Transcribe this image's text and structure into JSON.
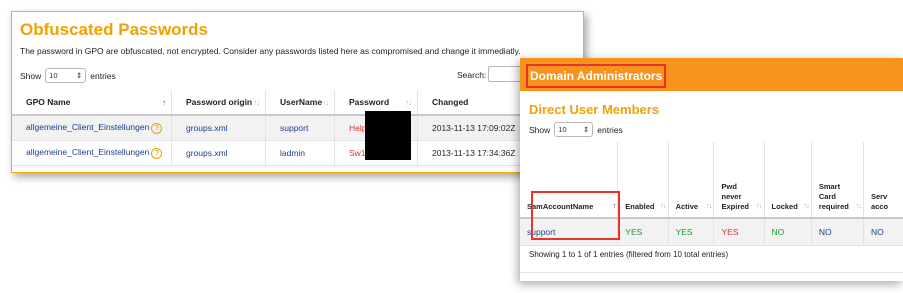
{
  "gpo_panel": {
    "title": "Obfuscated Passwords",
    "description": "The password in GPO are obfuscated, not encrypted. Consider any passwords listed here as compromised and change it immediatly.",
    "show_label": "Show",
    "entries_value": "10",
    "entries_label": "entries",
    "search_label": "Search:",
    "columns": [
      "GPO Name",
      "Password origin",
      "UserName",
      "Password",
      "Changed"
    ],
    "rows": [
      {
        "gpo_name": "allgemeine_Client_Einstellungen",
        "origin": "groups.xml",
        "username": "support",
        "password": "Help",
        "changed": "2013-11-13 17:09:02Z"
      },
      {
        "gpo_name": "allgemeine_Client_Einstellungen",
        "origin": "groups.xml",
        "username": "ladmin",
        "password": "Sw1",
        "changed": "2013-11-13 17:34:36Z"
      }
    ],
    "help_icon_glyph": "?"
  },
  "admins_panel": {
    "title": "Domain Administrators",
    "section_title": "Direct User Members",
    "show_label": "Show",
    "entries_value": "10",
    "entries_label": "entries",
    "columns": [
      {
        "line1": "SamAccountName",
        "line2": "",
        "line3": ""
      },
      {
        "line1": "Enabled",
        "line2": "",
        "line3": ""
      },
      {
        "line1": "Active",
        "line2": "",
        "line3": ""
      },
      {
        "line1": "Pwd",
        "line2": "never",
        "line3": "Expired"
      },
      {
        "line1": "Locked",
        "line2": "",
        "line3": ""
      },
      {
        "line1": "Smart",
        "line2": "Card",
        "line3": "required"
      },
      {
        "line1": "Serv",
        "line2": "acco",
        "line3": ""
      }
    ],
    "row": {
      "sam": "support",
      "enabled": "YES",
      "active": "YES",
      "pwd_never_expired": "YES",
      "locked": "NO",
      "smartcard": "NO",
      "service": "NO"
    },
    "footer": "Showing 1 to 1 of 1 entries (filtered from 10 total entries)"
  },
  "sort_glyphs": {
    "active": "↑",
    "inactive": "↑↓"
  },
  "colors": {
    "accent": "#f2a100",
    "header_orange": "#f7931e",
    "highlight_red": "#e8342a",
    "link_blue": "#1a3e8c",
    "yes_red": "#e0312f",
    "yes_green": "#1d9b2c"
  }
}
